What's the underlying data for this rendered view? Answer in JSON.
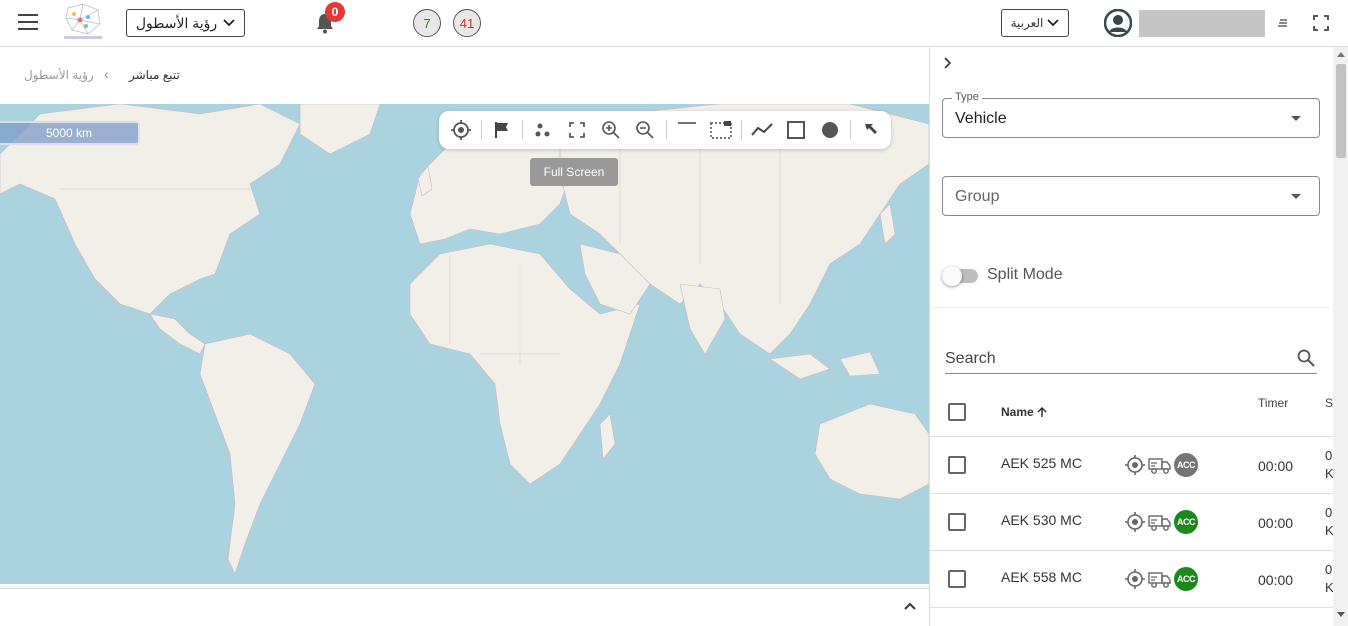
{
  "header": {
    "fleet_view_label": "رؤية الأسطول",
    "notification_count": "0",
    "count_green": "7",
    "count_red": "41",
    "language_label": "العربية",
    "colors": {
      "badge": "#e53935",
      "green_text": "#2e7d32",
      "red_text": "#d32f2f"
    }
  },
  "breadcrumb": {
    "parent": "رؤية الأسطول",
    "current": "تتبع مباشر"
  },
  "map": {
    "scale_label": "5000 km",
    "tooltip": "Full Screen",
    "toolbar": [
      "locate-icon",
      "flag-icon",
      "cluster-icon",
      "fullscreen-icon",
      "zoom-in-icon",
      "zoom-out-icon",
      "line-icon",
      "select-area-icon",
      "polyline-icon",
      "square-icon",
      "circle-icon",
      "pointer-icon"
    ]
  },
  "panel": {
    "type_label": "Type",
    "type_value": "Vehicle",
    "group_placeholder": "Group",
    "split_mode_label": "Split Mode",
    "search_placeholder": "Search",
    "columns": {
      "name": "Name",
      "timer": "Timer",
      "s": "S"
    },
    "rows": [
      {
        "name": "AEK 525 MC",
        "acc": "ACC",
        "acc_color": "#757575",
        "timer": "00:00",
        "cut1": "0",
        "cut2": "K"
      },
      {
        "name": "AEK 530 MC",
        "acc": "ACC",
        "acc_color": "#1b8a1b",
        "timer": "00:00",
        "cut1": "0",
        "cut2": "K"
      },
      {
        "name": "AEK 558 MC",
        "acc": "ACC",
        "acc_color": "#1b8a1b",
        "timer": "00:00",
        "cut1": "0",
        "cut2": "K"
      }
    ]
  }
}
